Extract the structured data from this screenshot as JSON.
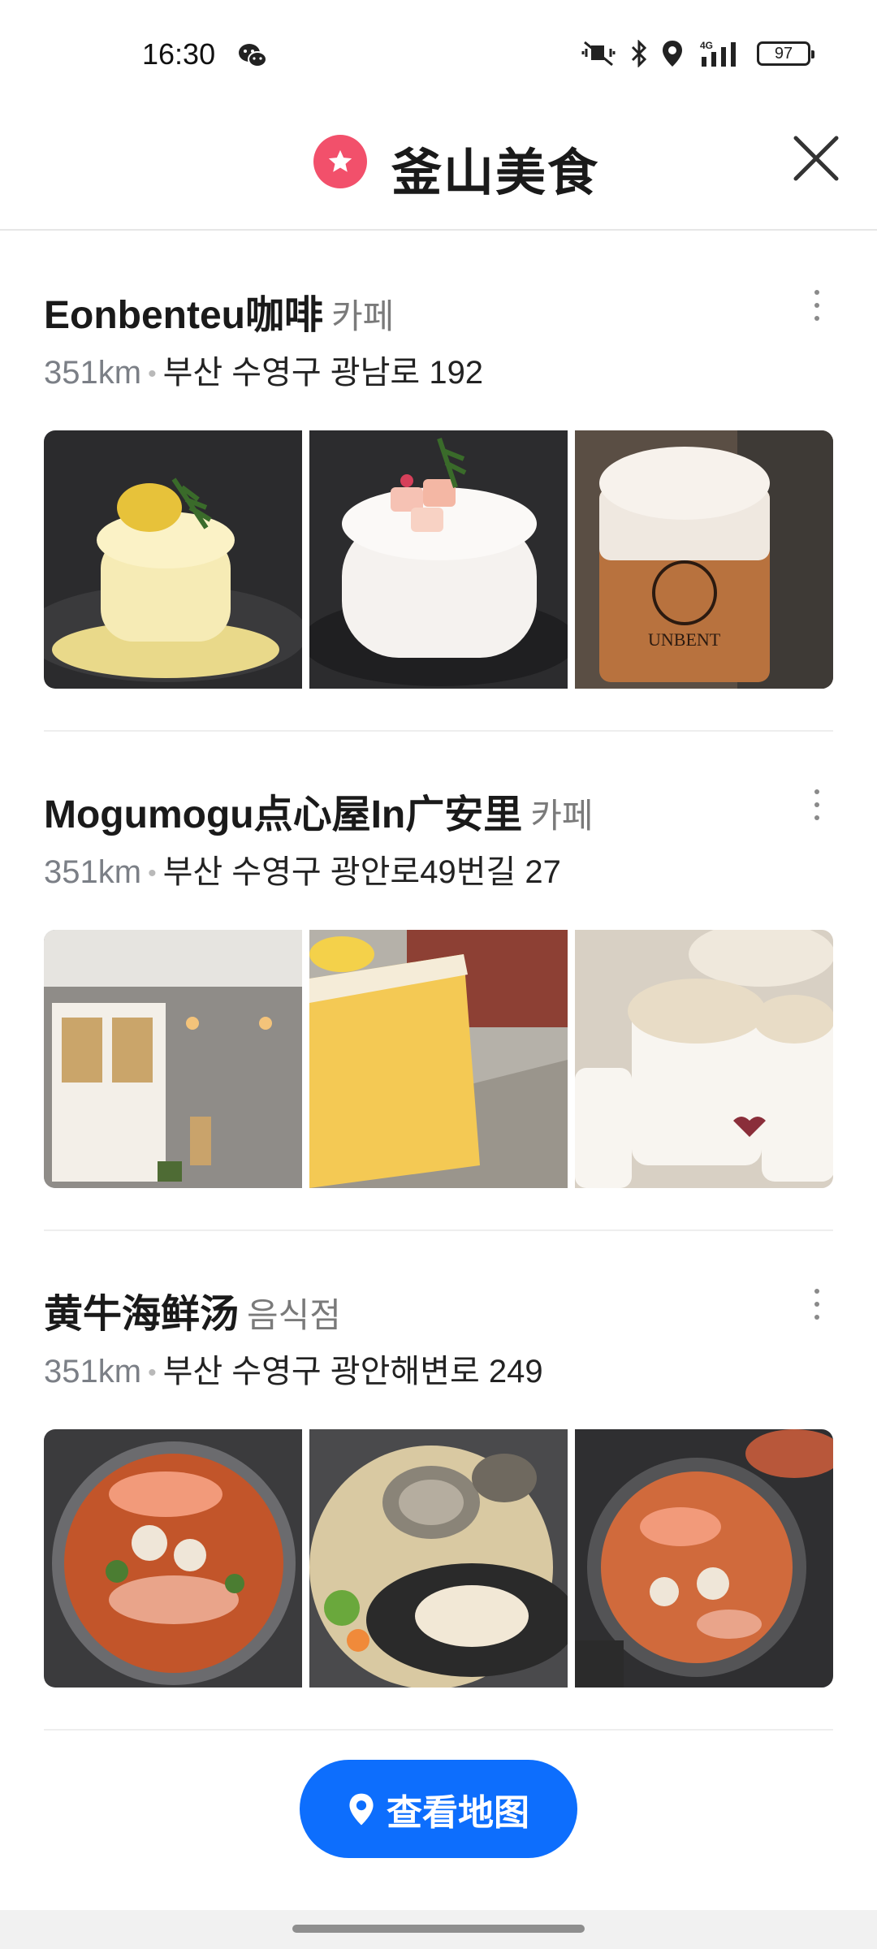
{
  "status_bar": {
    "time": "16:30",
    "battery": "97",
    "network": "4G"
  },
  "header": {
    "title": "釜山美食",
    "star_icon": "star-icon",
    "close_icon": "close-icon"
  },
  "places": [
    {
      "name": "Eonbenteu咖啡",
      "category": "카페",
      "distance": "351km",
      "address": "부산 수영구 광남로 192",
      "photos": [
        "souffle-pancake-lemon",
        "souffle-pancake-peach",
        "iced-latte-unbent"
      ]
    },
    {
      "name": "Mogumogu点心屋In广安里",
      "category": "카페",
      "distance": "351km",
      "address": "부산 수영구 광안로49번길 27",
      "photos": [
        "shop-storefront",
        "pound-cake",
        "pudding-cups"
      ]
    },
    {
      "name": "黄牛海鲜汤",
      "category": "음식점",
      "distance": "351km",
      "address": "부산 수영구 광안해변로 249",
      "photos": [
        "seafood-stew-1",
        "seafood-stew-2",
        "seafood-stew-3"
      ]
    }
  ],
  "map_button": {
    "label": "查看地图",
    "icon": "location-pin-icon"
  },
  "colors": {
    "accent_blue": "#0d6efd",
    "star_pink": "#f2506b",
    "secondary_text": "#7a7a7a"
  }
}
